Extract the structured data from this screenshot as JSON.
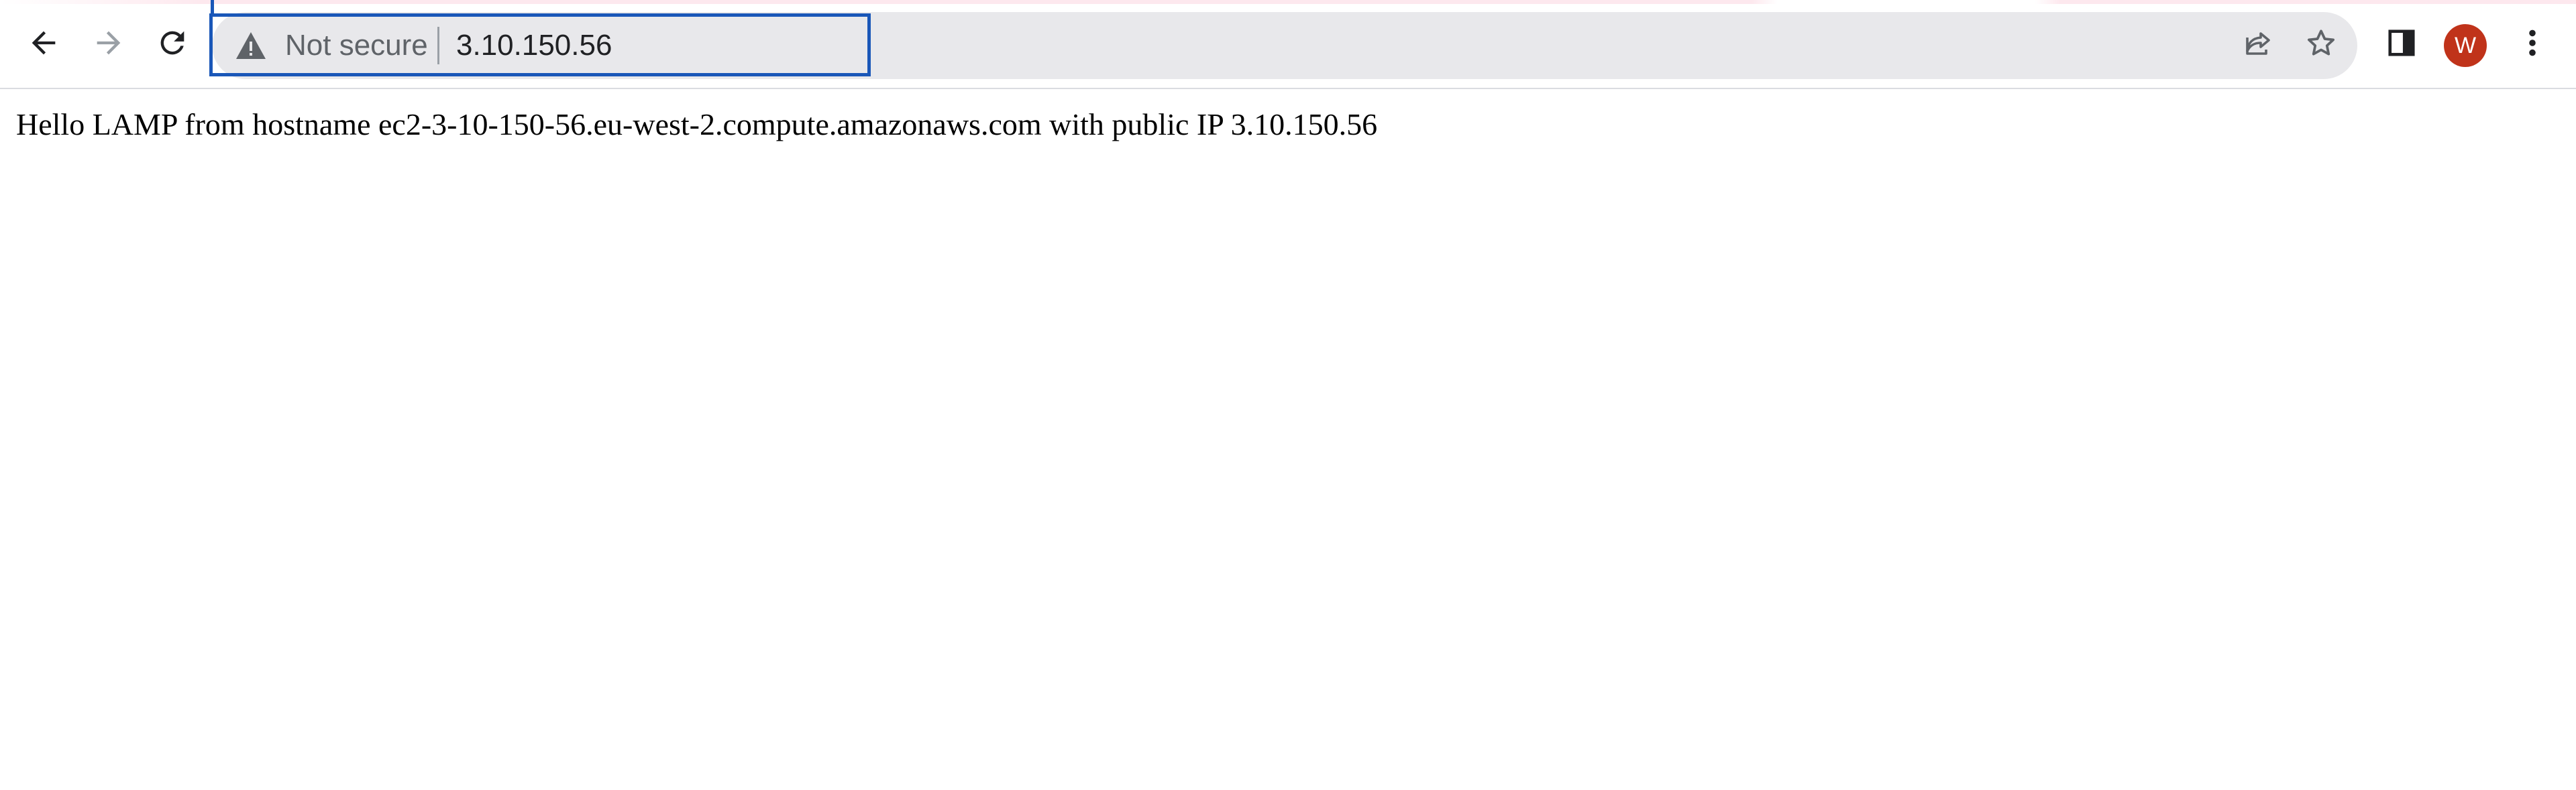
{
  "browser": {
    "nav": {
      "back_icon": "arrow-left-icon",
      "forward_icon": "arrow-right-icon",
      "reload_icon": "reload-icon"
    },
    "omnibox": {
      "security_label": "Not secure",
      "security_icon": "warning-triangle-icon",
      "url": "3.10.150.56",
      "focus_color": "#1a57b8"
    },
    "actions": {
      "share_icon": "share-icon",
      "bookmark_icon": "star-icon",
      "side_panel_icon": "side-panel-icon",
      "profile_initial": "W",
      "profile_color": "#c0331a",
      "menu_icon": "kebab-menu-icon"
    }
  },
  "page": {
    "body_text": "Hello LAMP from hostname ec2-3-10-150-56.eu-west-2.compute.amazonaws.com with public IP 3.10.150.56"
  }
}
